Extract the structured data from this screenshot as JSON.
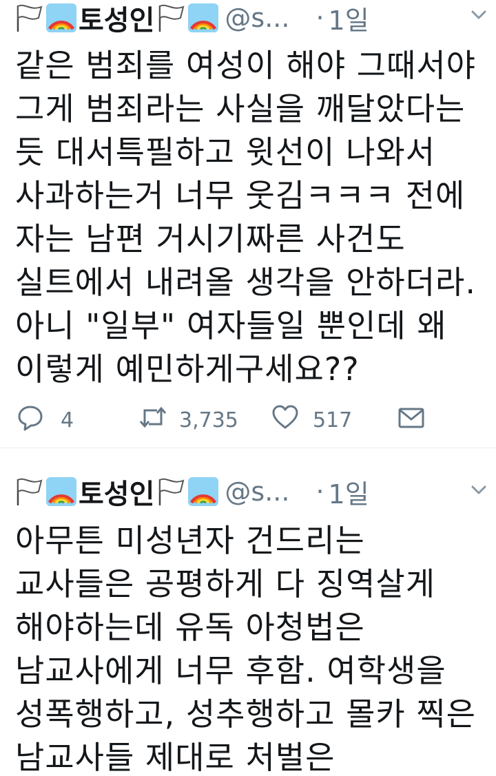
{
  "tweets": [
    {
      "display_name": "토성인",
      "handle": "@s...",
      "separator": "·",
      "time": "1일",
      "lines": [
        "같은 범죄를 여성이 해야 그때서야",
        "그게 범죄라는 사실을 깨달았다는",
        "듯 대서특필하고 윗선이 나와서",
        "사과하는거 너무 웃김ㅋㅋㅋ 전에",
        "자는 남편 거시기짜른 사건도",
        "실트에서 내려올 생각을 안하더라.",
        "아니 \"일부\" 여자들일 뿐인데 왜",
        "이렇게 예민하게구세요??"
      ],
      "actions": {
        "replies": "4",
        "retweets": "3,735",
        "likes": "517"
      }
    },
    {
      "display_name": "토성인",
      "handle": "@s...",
      "separator": "·",
      "time": "1일",
      "lines": [
        "아무튼 미성년자 건드리는",
        "교사들은 공평하게 다 징역살게",
        "해야하는데 유독 아청법은",
        "남교사에게 너무 후함. 여학생을",
        "성폭행하고, 성추행하고 몰카 찍은",
        "남교사들 제대로 처벌은"
      ]
    }
  ],
  "icons": {
    "flag": "white-flag-icon",
    "rainbow": "rainbow-icon",
    "caret": "chevron-down-icon",
    "reply": "reply-icon",
    "retweet": "retweet-icon",
    "like": "heart-icon",
    "dm": "envelope-icon"
  },
  "colors": {
    "text": "#14171a",
    "secondary": "#657786"
  }
}
